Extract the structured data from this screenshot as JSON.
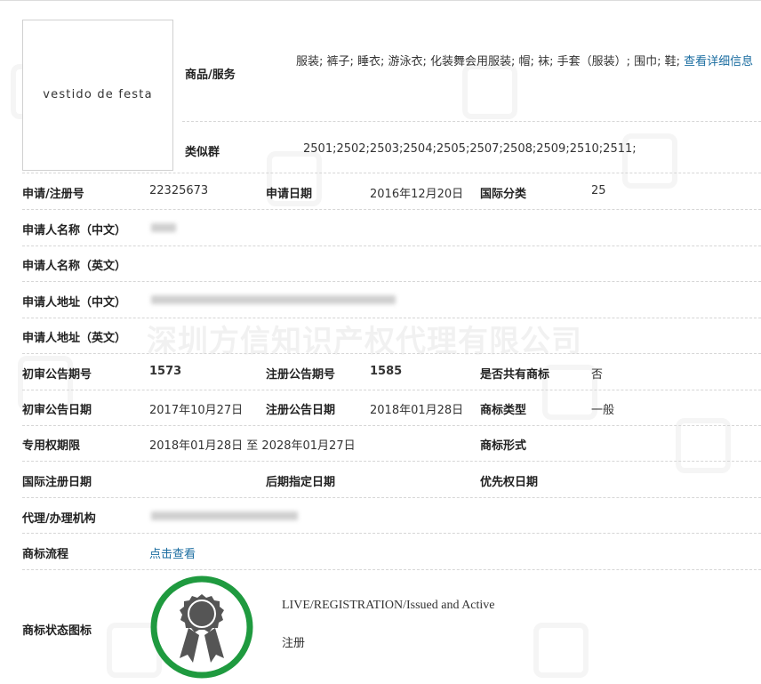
{
  "logo": {
    "text": "VESTIDO DE FESTA",
    "display": "vestido de festa"
  },
  "goods": {
    "label": "商品/服务",
    "text": "服装; 裤子; 睡衣; 游泳衣; 化装舞会用服装; 帽; 袜; 手套（服装）; 围巾; 鞋; ",
    "link_label": "查看详细信息"
  },
  "similar": {
    "label": "类似群",
    "value": "2501;2502;2503;2504;2505;2507;2508;2509;2510;2511;"
  },
  "reg_no": {
    "label": "申请/注册号",
    "value": "22325673"
  },
  "apply_date": {
    "label": "申请日期",
    "value": "2016年12月20日"
  },
  "intl_class": {
    "label": "国际分类",
    "value": "25"
  },
  "applicant_cn": {
    "label": "申请人名称（中文）"
  },
  "applicant_en": {
    "label": "申请人名称（英文）"
  },
  "address_cn": {
    "label": "申请人地址（中文）"
  },
  "address_en": {
    "label": "申请人地址（英文）"
  },
  "prelim_no": {
    "label": "初审公告期号",
    "value": "1573"
  },
  "reg_pub_no": {
    "label": "注册公告期号",
    "value": "1585"
  },
  "shared": {
    "label": "是否共有商标",
    "value": "否"
  },
  "prelim_date": {
    "label": "初审公告日期",
    "value": "2017年10月27日"
  },
  "reg_pub_date": {
    "label": "注册公告日期",
    "value": "2018年01月28日"
  },
  "tm_type": {
    "label": "商标类型",
    "value": "一般"
  },
  "term": {
    "label": "专用权期限",
    "value": "2018年01月28日 至 2028年01月27日"
  },
  "tm_form": {
    "label": "商标形式"
  },
  "intl_reg_date": {
    "label": "国际注册日期"
  },
  "later_date": {
    "label": "后期指定日期"
  },
  "priority_date": {
    "label": "优先权日期"
  },
  "agent": {
    "label": "代理/办理机构"
  },
  "process": {
    "label": "商标流程",
    "link_label": "点击查看"
  },
  "status": {
    "label": "商标状态图标",
    "text": "LIVE/REGISTRATION/Issued and Active",
    "cn": "注册"
  },
  "watermark": {
    "text": "深圳方信知识产权代理有限公司"
  },
  "colors": {
    "link": "#1a6ca0",
    "badge_ring": "#1f9a3f",
    "badge_icon": "#555555"
  },
  "icons": [
    "registration-badge-icon"
  ]
}
